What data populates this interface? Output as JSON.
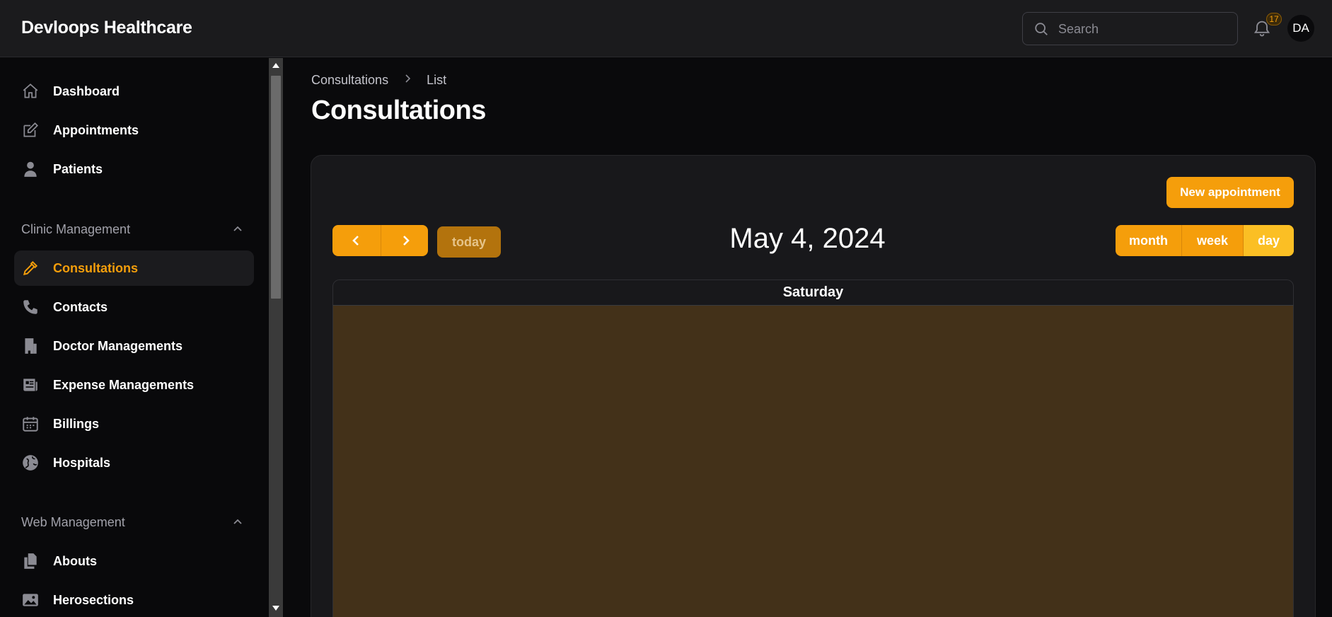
{
  "app": {
    "brand": "Devloops Healthcare"
  },
  "topbar": {
    "search_placeholder": "Search",
    "notification_count": "17",
    "avatar_initials": "DA"
  },
  "sidebar": {
    "items": [
      {
        "label": "Dashboard",
        "icon": "home-icon"
      },
      {
        "label": "Appointments",
        "icon": "pencil-square-icon"
      },
      {
        "label": "Patients",
        "icon": "user-icon"
      }
    ],
    "groups": [
      {
        "label": "Clinic Management",
        "expanded": true,
        "items": [
          {
            "label": "Consultations",
            "icon": "eyedropper-icon",
            "active": true
          },
          {
            "label": "Contacts",
            "icon": "phone-icon"
          },
          {
            "label": "Doctor Managements",
            "icon": "building-icon"
          },
          {
            "label": "Expense Managements",
            "icon": "newspaper-icon"
          },
          {
            "label": "Billings",
            "icon": "calendar-icon"
          },
          {
            "label": "Hospitals",
            "icon": "globe-icon"
          }
        ]
      },
      {
        "label": "Web Management",
        "expanded": true,
        "items": [
          {
            "label": "Abouts",
            "icon": "document-duplicate-icon"
          },
          {
            "label": "Herosections",
            "icon": "photo-icon"
          }
        ]
      }
    ]
  },
  "breadcrumb": {
    "items": [
      "Consultations",
      "List"
    ]
  },
  "page": {
    "title": "Consultations"
  },
  "calendar": {
    "new_button_label": "New appointment",
    "today_label": "today",
    "title": "May 4, 2024",
    "views": [
      "month",
      "week",
      "day"
    ],
    "active_view": "day",
    "day_header": "Saturday"
  },
  "colors": {
    "accent": "#f59e0b",
    "accent_active": "#fbbf24",
    "today_highlight": "#433119",
    "background": "#0a0a0c",
    "panel": "#18181b"
  }
}
